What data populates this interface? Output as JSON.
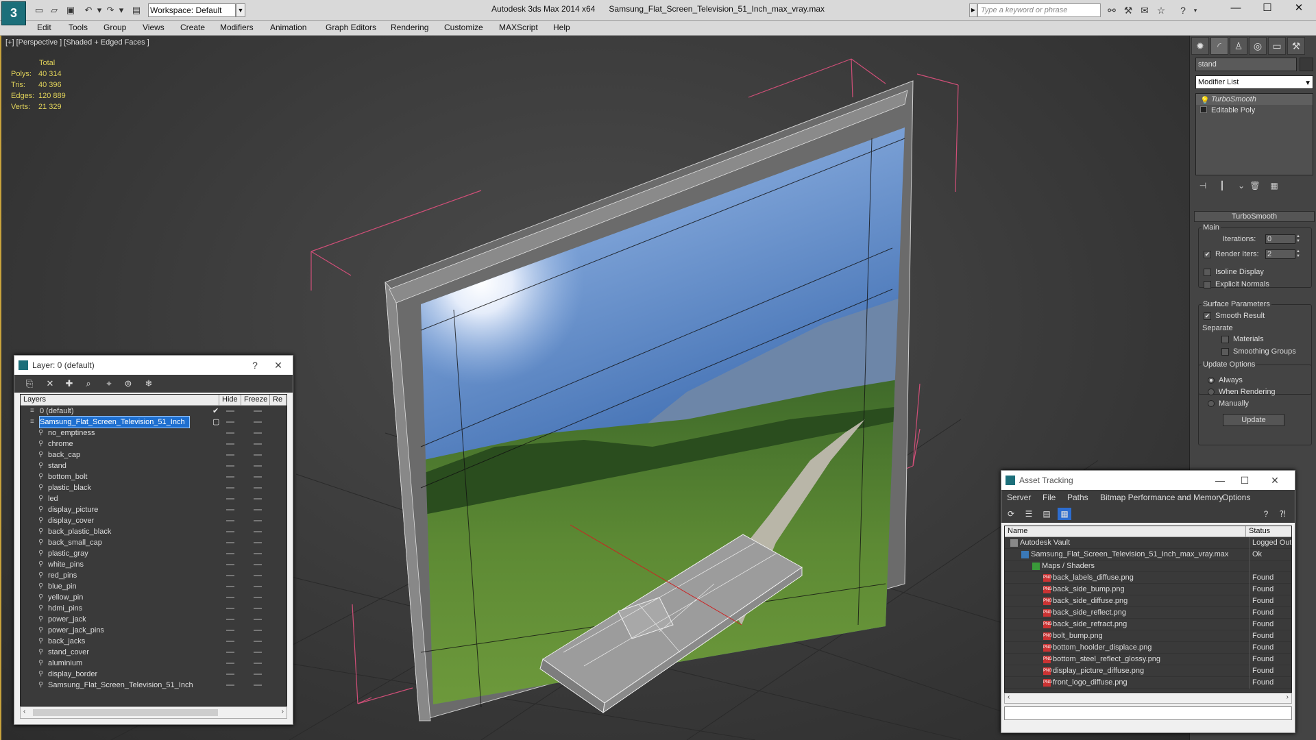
{
  "titlebar": {
    "workspace": "Workspace: Default",
    "app_name": "Autodesk 3ds Max  2014 x64",
    "file_name": "Samsung_Flat_Screen_Television_51_Inch_max_vray.max",
    "search_placeholder": "Type a keyword or phrase"
  },
  "menubar": [
    "Edit",
    "Tools",
    "Group",
    "Views",
    "Create",
    "Modifiers",
    "Animation",
    "Graph Editors",
    "Rendering",
    "Customize",
    "MAXScript",
    "Help"
  ],
  "viewport": {
    "label": "[+] [Perspective ] [Shaded + Edged Faces ]",
    "stats": {
      "header": "Total",
      "rows": [
        {
          "label": "Polys:",
          "value": "40 314"
        },
        {
          "label": "Tris:",
          "value": "40 396"
        },
        {
          "label": "Edges:",
          "value": "120 889"
        },
        {
          "label": "Verts:",
          "value": "21 329"
        }
      ]
    }
  },
  "command_panel": {
    "object_name": "stand",
    "modifier_list": "Modifier List",
    "stack": [
      "TurboSmooth",
      "Editable Poly"
    ],
    "rollout": "TurboSmooth",
    "main_group": "Main",
    "iterations_label": "Iterations:",
    "iterations_value": "0",
    "render_iters_label": "Render Iters:",
    "render_iters_value": "2",
    "isoline": "Isoline Display",
    "explicit_normals": "Explicit Normals",
    "surface_group": "Surface Parameters",
    "smooth_result": "Smooth Result",
    "separate": "Separate",
    "materials": "Materials",
    "smoothing_groups": "Smoothing Groups",
    "update_group": "Update Options",
    "always": "Always",
    "when_rendering": "When Rendering",
    "manually": "Manually",
    "update_button": "Update"
  },
  "layer_window": {
    "title": "Layer: 0 (default)",
    "help": "?",
    "columns": [
      "Layers",
      "Hide",
      "Freeze",
      "Re"
    ],
    "layers": [
      {
        "name": "0 (default)",
        "level": 0,
        "check": "✔"
      },
      {
        "name": "Samsung_Flat_Screen_Television_51_Inch",
        "level": 0,
        "selected": true,
        "check": "▢"
      },
      {
        "name": "no_emptiness",
        "level": 1
      },
      {
        "name": "chrome",
        "level": 1
      },
      {
        "name": "back_cap",
        "level": 1
      },
      {
        "name": "stand",
        "level": 1
      },
      {
        "name": "bottom_bolt",
        "level": 1
      },
      {
        "name": "plastic_black",
        "level": 1
      },
      {
        "name": "led",
        "level": 1
      },
      {
        "name": "display_picture",
        "level": 1
      },
      {
        "name": "display_cover",
        "level": 1
      },
      {
        "name": "back_plastic_black",
        "level": 1
      },
      {
        "name": "back_small_cap",
        "level": 1
      },
      {
        "name": "plastic_gray",
        "level": 1
      },
      {
        "name": "white_pins",
        "level": 1
      },
      {
        "name": "red_pins",
        "level": 1
      },
      {
        "name": "blue_pin",
        "level": 1
      },
      {
        "name": "yellow_pin",
        "level": 1
      },
      {
        "name": "hdmi_pins",
        "level": 1
      },
      {
        "name": "power_jack",
        "level": 1
      },
      {
        "name": "power_jack_pins",
        "level": 1
      },
      {
        "name": "back_jacks",
        "level": 1
      },
      {
        "name": "stand_cover",
        "level": 1
      },
      {
        "name": "aluminium",
        "level": 1
      },
      {
        "name": "display_border",
        "level": 1
      },
      {
        "name": "Samsung_Flat_Screen_Television_51_Inch",
        "level": 1
      }
    ]
  },
  "asset_window": {
    "title": "Asset Tracking",
    "menu": [
      "Server",
      "File",
      "Paths",
      "Bitmap Performance and Memory",
      "Options"
    ],
    "columns": [
      "Name",
      "Status"
    ],
    "rows": [
      {
        "name": "Autodesk Vault",
        "status": "Logged Out",
        "level": 0
      },
      {
        "name": "Samsung_Flat_Screen_Television_51_Inch_max_vray.max",
        "status": "Ok",
        "level": 1
      },
      {
        "name": "Maps / Shaders",
        "status": "",
        "level": 2
      },
      {
        "name": "back_labels_diffuse.png",
        "status": "Found",
        "level": 3
      },
      {
        "name": "back_side_bump.png",
        "status": "Found",
        "level": 3
      },
      {
        "name": "back_side_diffuse.png",
        "status": "Found",
        "level": 3
      },
      {
        "name": "back_side_reflect.png",
        "status": "Found",
        "level": 3
      },
      {
        "name": "back_side_refract.png",
        "status": "Found",
        "level": 3
      },
      {
        "name": "bolt_bump.png",
        "status": "Found",
        "level": 3
      },
      {
        "name": "bottom_hoolder_displace.png",
        "status": "Found",
        "level": 3
      },
      {
        "name": "bottom_steel_reflect_glossy.png",
        "status": "Found",
        "level": 3
      },
      {
        "name": "display_picture_diffuse.png",
        "status": "Found",
        "level": 3
      },
      {
        "name": "front_logo_diffuse.png",
        "status": "Found",
        "level": 3
      }
    ]
  },
  "colors": {
    "accent": "#1e6fd0",
    "stats": "#e0d25a",
    "bbox": "#d04f78"
  }
}
